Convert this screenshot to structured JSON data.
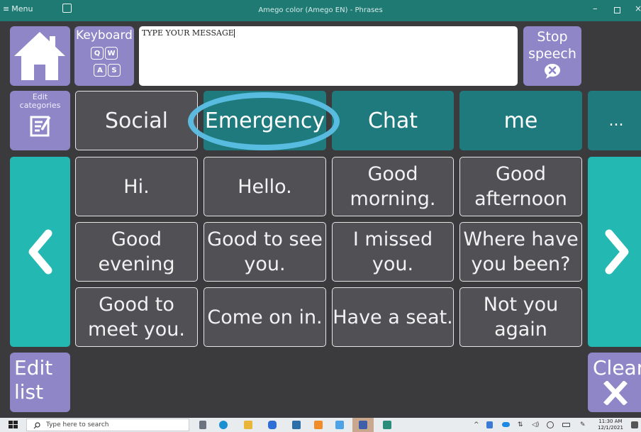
{
  "titlebar": {
    "menu_label": "Menu",
    "title": "Amego color (Amego EN) - Phrases",
    "minimize": "–",
    "close": "×"
  },
  "toolbar": {
    "keyboard_label": "Keyboard",
    "keys": [
      "Q",
      "W",
      "A",
      "S"
    ],
    "message_text": "TYPE YOUR MESSAGE",
    "stop_label_1": "Stop",
    "stop_label_2": "speech"
  },
  "categories": {
    "edit_label_1": "Edit",
    "edit_label_2": "categories",
    "items": [
      "Social",
      "Emergency",
      "Chat",
      "me",
      "..."
    ]
  },
  "phrases": [
    [
      "Hi."
    ],
    [
      "Hello."
    ],
    [
      "Good",
      "morning."
    ],
    [
      "Good",
      "afternoon"
    ],
    [
      "Good",
      "evening"
    ],
    [
      "Good to see",
      "you."
    ],
    [
      "I missed",
      "you."
    ],
    [
      "Where have",
      "you been?"
    ],
    [
      "Good to",
      "meet you."
    ],
    [
      "Come on in."
    ],
    [
      "Have a seat."
    ],
    [
      "Not you",
      "again"
    ]
  ],
  "bottom": {
    "edit_list_1": "Edit",
    "edit_list_2": "list",
    "clear_label": "Clear"
  },
  "taskbar": {
    "search_placeholder": "Type here to search",
    "time": "11:30 AM",
    "date": "12/1/2021"
  },
  "colors": {
    "accent_purple": "#8f86c8",
    "category_teal": "#1f7a7e",
    "nav_teal": "#24b8b3",
    "annotation_circle": "#5cc0e6"
  }
}
